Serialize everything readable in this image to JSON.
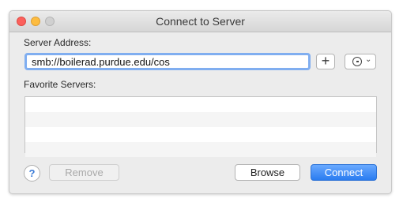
{
  "window": {
    "title": "Connect to Server"
  },
  "server_address": {
    "label": "Server Address:",
    "value": "smb://boilerad.purdue.edu/cos"
  },
  "toolbar": {
    "add_icon": "plus-icon",
    "recent_icon": "clock-icon",
    "recent_chevron": "chevron-down-icon"
  },
  "favorites": {
    "label": "Favorite Servers:",
    "rows": [
      "",
      "",
      "",
      ""
    ]
  },
  "buttons": {
    "help": "?",
    "remove": "Remove",
    "browse": "Browse",
    "connect": "Connect"
  },
  "colors": {
    "accent": "#2a7cf0",
    "focus_ring": "#80aef0"
  }
}
